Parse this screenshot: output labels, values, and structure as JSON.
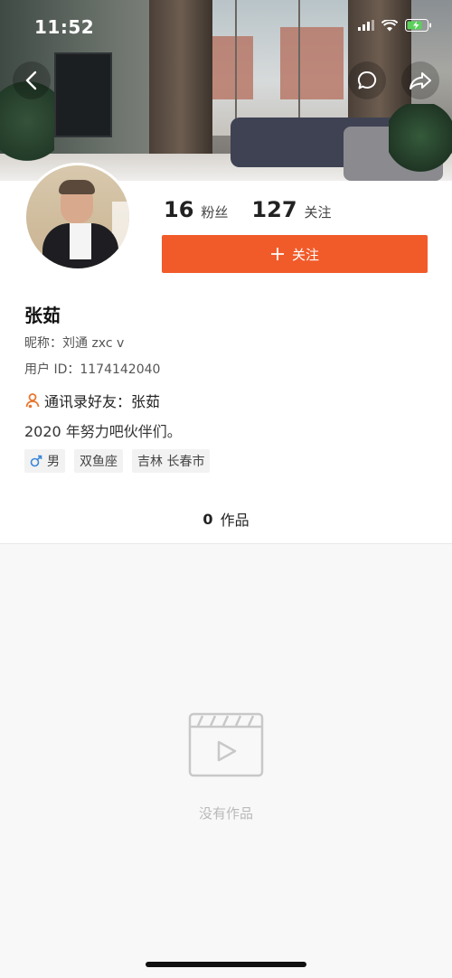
{
  "status_bar": {
    "time": "11:52"
  },
  "profile": {
    "name": "张茹",
    "nickname_label": "昵称：",
    "nickname_value": "刘通 zxc v",
    "user_id_label": "用户 ID：",
    "user_id_value": "1174142040",
    "contact_label": "通讯录好友：",
    "contact_value": "张茹",
    "bio": "2020 年努力吧伙伴们。",
    "tags": [
      "男",
      "双鱼座",
      "吉林 长春市"
    ]
  },
  "stats": {
    "fans_count": "16",
    "fans_label": "粉丝",
    "following_count": "127",
    "following_label": "关注"
  },
  "follow_button": {
    "label": "关注"
  },
  "works": {
    "count": "0",
    "label": "作品",
    "empty_text": "没有作品"
  },
  "colors": {
    "accent": "#f15b2a",
    "male_icon": "#3a86d8",
    "contact_icon": "#e8772e"
  },
  "icons": {
    "back": "back-icon",
    "comment": "comment-icon",
    "share": "share-icon",
    "contact": "contact-icon",
    "male": "male-icon",
    "video": "video-icon"
  }
}
